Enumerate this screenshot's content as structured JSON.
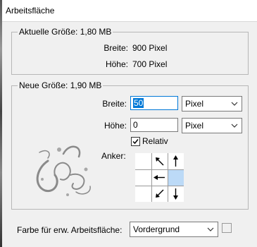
{
  "window": {
    "title": "Arbeitsfläche"
  },
  "current_size": {
    "legend": "Aktuelle Größe: 1,80 MB",
    "width_label": "Breite:",
    "width_value": "900 Pixel",
    "height_label": "Höhe:",
    "height_value": "700 Pixel"
  },
  "new_size": {
    "legend": "Neue Größe: 1,90 MB",
    "width_label": "Breite:",
    "width_value": "50",
    "width_unit": "Pixel",
    "height_label": "Höhe:",
    "height_value": "0",
    "height_unit": "Pixel",
    "relative_label": "Relativ",
    "relative_checked": true,
    "anchor_label": "Anker:",
    "anchor_selected": "center-left"
  },
  "canvas_color": {
    "label": "Farbe für erw. Arbeitsfläche:",
    "value": "Vordergrund"
  },
  "colors": {
    "accent": "#0078d7",
    "anchor_selected_bg": "#bcdaf7",
    "dialog_bg": "#f0f0f0"
  }
}
